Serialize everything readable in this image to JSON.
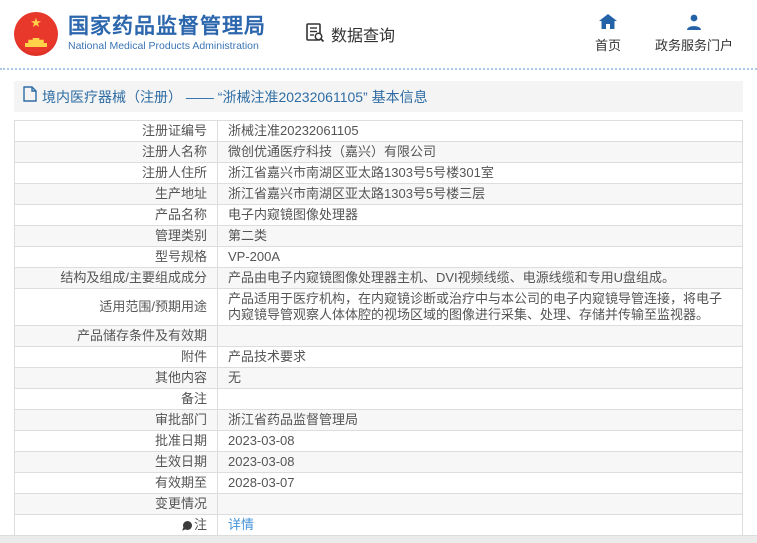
{
  "header": {
    "brand_cn": "国家药品监督管理局",
    "brand_en": "National Medical Products Administration",
    "data_query_label": "数据查询",
    "nav": [
      {
        "label": "首页",
        "icon": "home-icon"
      },
      {
        "label": "政务服务门户",
        "icon": "person-icon"
      }
    ]
  },
  "breadcrumb": {
    "text": "境内医疗器械（注册） —— “浙械注准20232061105” 基本信息",
    "icon": "document-icon"
  },
  "table": {
    "rows": [
      {
        "label": "注册证编号",
        "value": "浙械注准20232061105"
      },
      {
        "label": "注册人名称",
        "value": "微创优通医疗科技（嘉兴）有限公司"
      },
      {
        "label": "注册人住所",
        "value": "浙江省嘉兴市南湖区亚太路1303号5号楼301室"
      },
      {
        "label": "生产地址",
        "value": "浙江省嘉兴市南湖区亚太路1303号5号楼三层"
      },
      {
        "label": "产品名称",
        "value": "电子内窥镜图像处理器"
      },
      {
        "label": "管理类别",
        "value": "第二类"
      },
      {
        "label": "型号规格",
        "value": "VP-200A"
      },
      {
        "label": "结构及组成/主要组成成分",
        "value": "产品由电子内窥镜图像处理器主机、DVI视频线缆、电源线缆和专用U盘组成。"
      },
      {
        "label": "适用范围/预期用途",
        "value": "产品适用于医疗机构，在内窥镜诊断或治疗中与本公司的电子内窥镜导管连接，将电子内窥镜导管观察人体体腔的视场区域的图像进行采集、处理、存储并传输至监视器。"
      },
      {
        "label": "产品储存条件及有效期",
        "value": ""
      },
      {
        "label": "附件",
        "value": "产品技术要求"
      },
      {
        "label": "其他内容",
        "value": "无"
      },
      {
        "label": "备注",
        "value": ""
      },
      {
        "label": "审批部门",
        "value": "浙江省药品监督管理局"
      },
      {
        "label": "批准日期",
        "value": "2023-03-08"
      },
      {
        "label": "生效日期",
        "value": "2023-03-08"
      },
      {
        "label": "有效期至",
        "value": "2028-03-07"
      },
      {
        "label": "变更情况",
        "value": ""
      },
      {
        "label": "注",
        "value": "详情",
        "label_icon": "note-icon",
        "value_is_link": true
      }
    ]
  },
  "colors": {
    "brand_blue": "#2c66ad",
    "crumb_blue": "#2e6da4",
    "link_blue": "#4393d8",
    "row_alt_bg": "#f7f7f7",
    "emblem_red": "#d7281a",
    "emblem_yellow": "#ffd24a"
  }
}
